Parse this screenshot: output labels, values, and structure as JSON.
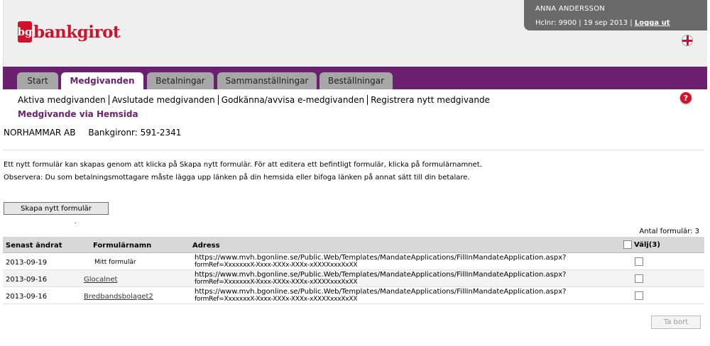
{
  "brand": {
    "logo_text": "bankgirot",
    "logo_mark": "bg"
  },
  "user": {
    "name": "ANNA ANDERSSON",
    "client_no": "Hclnr: 9900",
    "date": "19 sep 2013",
    "sep": "|",
    "logout": "Logga ut"
  },
  "language_icon": "uk-flag-icon",
  "tabs": [
    {
      "label": "Start",
      "active": false
    },
    {
      "label": "Medgivanden",
      "active": true
    },
    {
      "label": "Betalningar",
      "active": false
    },
    {
      "label": "Sammanställningar",
      "active": false
    },
    {
      "label": "Beställningar",
      "active": false
    }
  ],
  "subnav": [
    "Aktiva medgivanden",
    "Avslutade medgivanden",
    "Godkänna/avvisa e-medgivanden",
    "Registrera nytt medgivande"
  ],
  "subnav_active": "Medgivande via Hemsida",
  "help_icon": "?",
  "company": {
    "name": "NORHAMMAR AB",
    "bankgiro": "Bankgironr: 591-2341"
  },
  "info": {
    "line1": "Ett nytt formulär kan skapas genom att klicka på Skapa nytt formulär. För att editera ett befintligt formulär, klicka på formulärnamnet.",
    "line2": "Observera: Du som betalningsmottagare måste lägga upp länken på din hemsida eller bifoga länken på annat sätt till din betalare."
  },
  "create_button": "Skapa nytt formulär",
  "dot": ".",
  "count": "Antal formulär:  3",
  "table": {
    "headers": {
      "date": "Senast ändrat",
      "name": "Formulärnamn",
      "address": "Adress",
      "select": "Välj(3)"
    },
    "rows": [
      {
        "date": "2013-09-19",
        "name": "Mitt formulär",
        "link": false,
        "address1": "https://www.mvh.bgonline.se/Public.Web/Templates/MandateApplications/FillInMandateApplication.aspx?",
        "address2": "formRef=XxxxxxxX-Xxxx-XXXx-XXXx-xXXXXxxxXxXX"
      },
      {
        "date": "2013-09-16",
        "name": "Glocalnet",
        "link": true,
        "address1": "https://www.mvh.bgonline.se/Public.Web/Templates/MandateApplications/FillInMandateApplication.aspx?",
        "address2": "formRef=XxxxxxxX-Xxxx-XXXx-XXXx-xXXXXxxxXxXX"
      },
      {
        "date": "2013-09-16",
        "name": "Bredbandsbolaget2",
        "link": true,
        "address1": "https://www.mvh.bgonline.se/Public.Web/Templates/MandateApplications/FillInMandateApplication.aspx?",
        "address2": "formRef=XxxxxxxX-Xxxx-XXXx-XXXx-xXXXXxxxXxXX"
      }
    ]
  },
  "remove_button": "Ta bort"
}
